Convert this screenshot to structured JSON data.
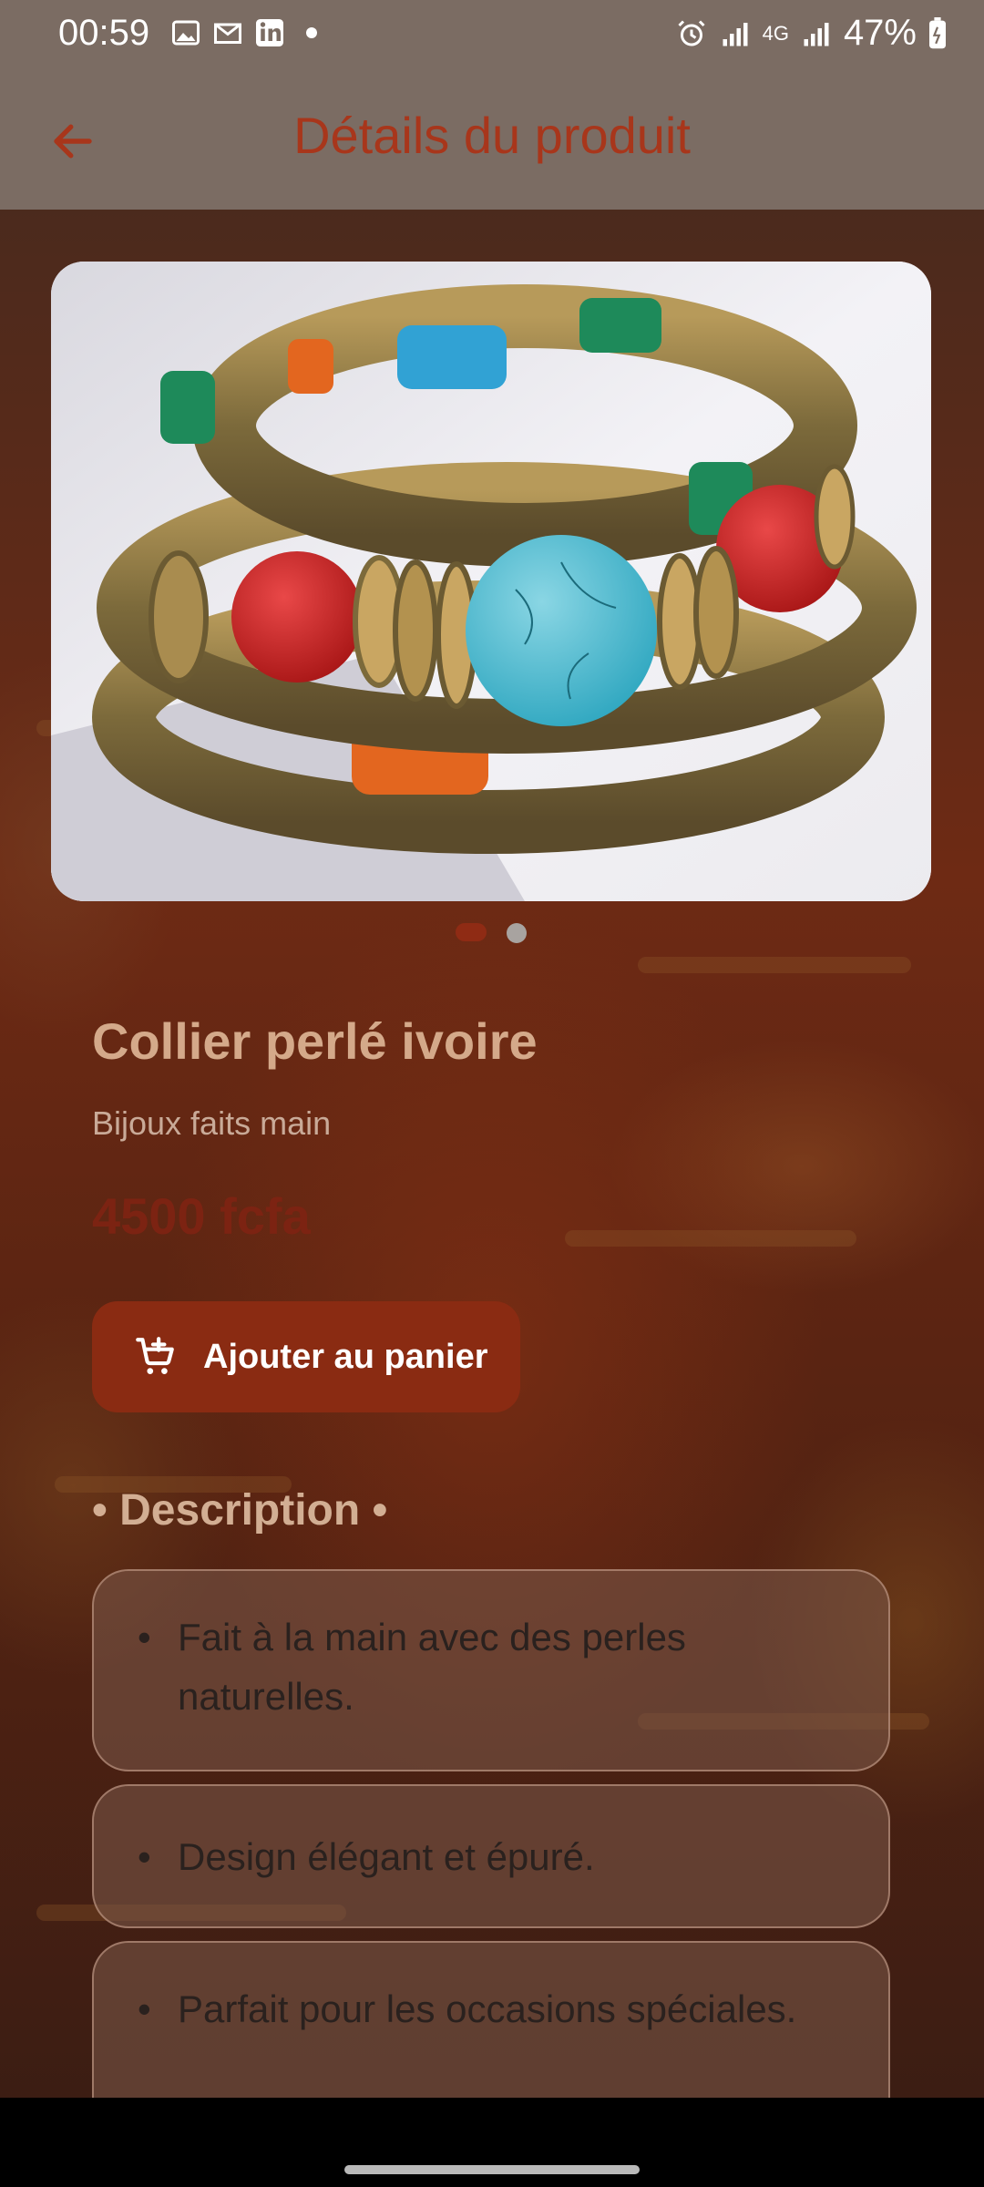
{
  "status_bar": {
    "time": "00:59",
    "battery": "47%",
    "network": "4G"
  },
  "app_bar": {
    "title": "Détails du produit"
  },
  "carousel": {
    "image_description": "product-photo-bracelet",
    "page_count": 2,
    "active_page": 1
  },
  "product": {
    "name": "Collier perlé ivoire",
    "category": "Bijoux faits main",
    "price": "4500 fcfa"
  },
  "add_to_cart": {
    "label": "Ajouter au panier"
  },
  "description": {
    "title": "• Description •",
    "items": [
      {
        "bullet": "•",
        "text": "Fait à la main avec des perles naturelles."
      },
      {
        "bullet": "•",
        "text": "Design élégant et épuré."
      },
      {
        "bullet": "•",
        "text": "Parfait pour les occasions spéciales."
      }
    ]
  },
  "colors": {
    "app_bar": "#7b6c63",
    "title": "#a8361b",
    "button": "#8a2b12",
    "price": "#7c2312"
  }
}
